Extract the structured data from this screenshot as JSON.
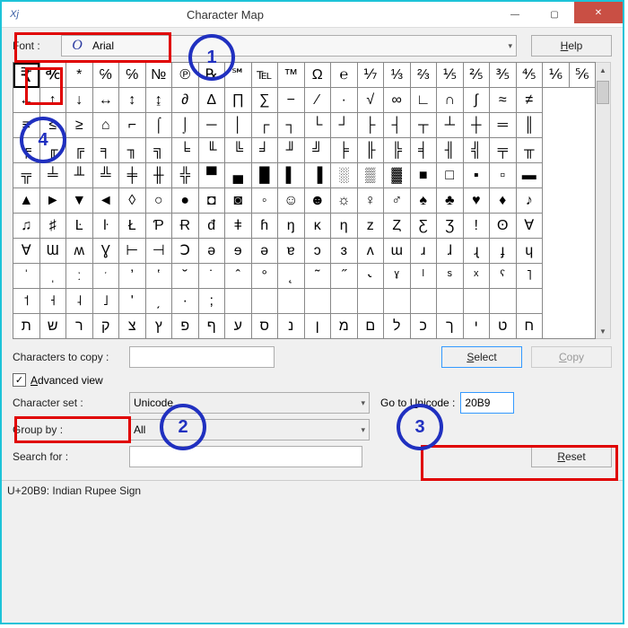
{
  "window": {
    "title": "Character Map",
    "icon_glyph": "Xj"
  },
  "titlebar_buttons": {
    "minimize": "—",
    "maximize": "▢",
    "close": "✕"
  },
  "font_row": {
    "label": "Font :",
    "preview_glyph": "O",
    "font_name": "Arial",
    "help_label": "Help",
    "help_accel": "H"
  },
  "grid": {
    "rows": [
      [
        "₹",
        "℀",
        "*",
        "℅",
        "℅",
        "№",
        "℗",
        "℞",
        "℠",
        "℡",
        "™",
        "Ω",
        "℮",
        "⅐",
        "⅓",
        "⅔",
        "⅕",
        "⅖",
        "⅗",
        "⅘",
        "⅙",
        "⅚"
      ],
      [
        "←",
        "↑",
        "↓",
        "↔",
        "↕",
        "↨",
        "∂",
        "Δ",
        "∏",
        "∑",
        "−",
        "∕",
        "∙",
        "√",
        "∞",
        "∟",
        "∩",
        "∫",
        "≈",
        "≠"
      ],
      [
        "≡",
        "≤",
        "≥",
        "⌂",
        "⌐",
        "⌠",
        "⌡",
        "─",
        "│",
        "┌",
        "┐",
        "└",
        "┘",
        "├",
        "┤",
        "┬",
        "┴",
        "┼",
        "═",
        "║"
      ],
      [
        "╒",
        "╓",
        "╔",
        "╕",
        "╖",
        "╗",
        "╘",
        "╙",
        "╚",
        "╛",
        "╜",
        "╝",
        "╞",
        "╟",
        "╠",
        "╡",
        "╢",
        "╣",
        "╤",
        "╥"
      ],
      [
        "╦",
        "╧",
        "╨",
        "╩",
        "╪",
        "╫",
        "╬",
        "▀",
        "▄",
        "█",
        "▌",
        "▐",
        "░",
        "▒",
        "▓",
        "■",
        "□",
        "▪",
        "▫",
        "▬"
      ],
      [
        "▲",
        "►",
        "▼",
        "◄",
        "◊",
        "○",
        "●",
        "◘",
        "◙",
        "◦",
        "☺",
        "☻",
        "☼",
        "♀",
        "♂",
        "♠",
        "♣",
        "♥",
        "♦",
        "♪"
      ],
      [
        "♫",
        "♯",
        "Ŀ",
        "ŀ",
        "Ł",
        "Ƥ",
        "Ɍ",
        "đ",
        "ǂ",
        "ɦ",
        "ŋ",
        "ĸ",
        "ƞ",
        "z",
        "Ȥ",
        "Ƹ",
        "Ʒ",
        "ǃ",
        "ʘ",
        "∀"
      ],
      [
        "Ɐ",
        "Ɯ",
        "ʍ",
        "Ɣ",
        "⊢",
        "⊣",
        "Ↄ",
        "ә",
        "ɘ",
        "ə",
        "ɐ",
        "ɔ",
        "ɜ",
        "ʌ",
        "ɯ",
        "ɹ",
        "ɺ",
        "ɻ",
        "ɟ",
        "ɥ"
      ],
      [
        "ˈ",
        "ˌ",
        "ː",
        "ˑ",
        "ʼ",
        "ʽ",
        "˘",
        "˙",
        "ˆ",
        "°",
        "˛",
        "˜",
        "˝",
        "˞",
        "ˠ",
        "ˡ",
        "ˢ",
        "ˣ",
        "ˤ",
        "˥"
      ],
      [
        "˦",
        "˧",
        "˨",
        "˩",
        "ʹ",
        "͵",
        "·",
        ";",
        " ",
        " ",
        " ",
        " ",
        " ",
        " ",
        " ",
        " ",
        " ",
        " ",
        " ",
        " "
      ],
      [
        "ת",
        "ש",
        "ר",
        "ק",
        "צ",
        "ץ",
        "פ",
        "ף",
        "ע",
        "ס",
        "נ",
        "ן",
        "מ",
        "ם",
        "ל",
        "כ",
        "ך",
        "י",
        "ט",
        "ח"
      ]
    ],
    "selected_row": 0,
    "selected_col": 0
  },
  "copy_row": {
    "label": "Characters to copy :",
    "value": "",
    "select_label": "Select",
    "select_accel": "S",
    "copy_label": "Copy",
    "copy_accel": "C"
  },
  "advanced": {
    "checked": true,
    "label": "Advanced view",
    "accel": "A"
  },
  "charset_row": {
    "label": "Character set :",
    "value": "Unicode"
  },
  "goto_row": {
    "label": "Go to Unicode :",
    "accel": "U",
    "value": "20B9"
  },
  "group_row": {
    "label": "Group by :",
    "value": "All"
  },
  "search_row": {
    "label": "Search for :",
    "value": "",
    "reset_label": "Reset",
    "reset_accel": "R"
  },
  "status": "U+20B9: Indian Rupee Sign",
  "annotations": {
    "n1": "1",
    "n2": "2",
    "n3": "3",
    "n4": "4"
  }
}
